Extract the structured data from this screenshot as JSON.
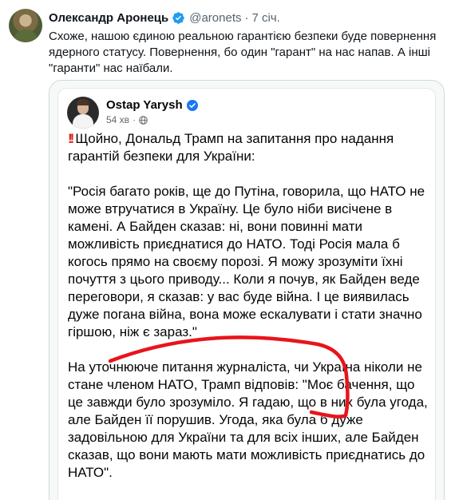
{
  "tweet": {
    "author_name": "Олександр Аронець",
    "handle": "@aronets",
    "separator": "·",
    "time": "7 січ.",
    "text": "Схоже, нашою єдиною реальною гарантією безпеки буде повернення ядерного статусу. Повернення, бо один \"гарант\" на нас напав. А інші \"гаранти\" нас наїбали."
  },
  "embedded_post": {
    "author_name": "Ostap Yarysh",
    "time": "54 хв",
    "separator": "·",
    "emoji": "!!",
    "paragraph_1": "Щойно, Дональд Трамп на запитання про надання гарантій безпеки для України:",
    "paragraph_2": "\"Росія багато років, ще до Путіна, говорила, що НАТО не може втручатися в Україну. Це було ніби висічене в камені. А Байден сказав: ні, вони повинні мати можливість приєднатися до НАТО. Тоді Росія мала б когось прямо на своєму порозі. Я можу зрозуміти їхні почуття з цього приводу... Коли я почув, як Байден веде переговори, я сказав: у вас буде війна. І це виявилась дуже погана війна, вона може ескалувати і стати значно гіршою, ніж є зараз.\"",
    "paragraph_3": "На уточнюючe питання журналіста, чи Україна ніколи не стане членом НАТО, Трамп відповів: \"Моє бачення, що це завжди було зрозуміло. Я гадаю, що в них була угода, але Байден її порушив. Угода, яка була б дуже задовільною для України та для всіх інших, але Байден сказав, що вони мають мати можливість приєднатись до НАТО\"."
  },
  "icons": {
    "verified": "verified-badge-icon",
    "globe": "globe-icon",
    "marker": "red-marker-annotation"
  },
  "colors": {
    "verified_blue": "#1d9bf0",
    "fb_blue": "#1877f2",
    "marker_red": "#e8141c",
    "text_secondary": "#536471"
  }
}
